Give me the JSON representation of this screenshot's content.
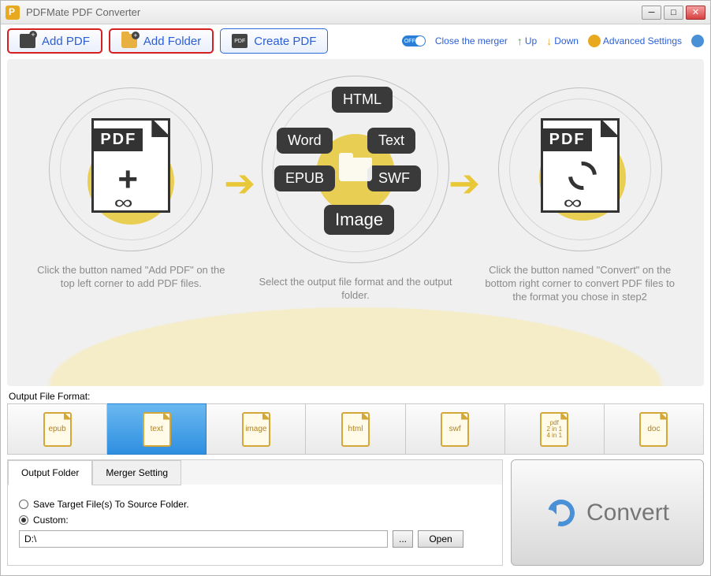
{
  "window": {
    "title": "PDFMate PDF Converter"
  },
  "toolbar": {
    "add_pdf": "Add PDF",
    "add_folder": "Add Folder",
    "create_pdf": "Create PDF",
    "toggle_label": "OFF",
    "close_merger": "Close the merger",
    "up": "Up",
    "down": "Down",
    "advanced": "Advanced Settings"
  },
  "steps": {
    "s1_label": "PDF",
    "s1_caption": "Click the button named \"Add PDF\" on the top left corner to add PDF files.",
    "s2_badges": {
      "html": "HTML",
      "word": "Word",
      "text": "Text",
      "epub": "EPUB",
      "swf": "SWF",
      "image": "Image"
    },
    "s2_caption": "Select the output file format and the output folder.",
    "s3_label": "PDF",
    "s3_caption": "Click the button named \"Convert\" on the bottom right corner to convert PDF files to the format you chose in step2"
  },
  "format_section": {
    "label": "Output File Format:",
    "items": [
      "epub",
      "text",
      "image",
      "html",
      "swf",
      "pdf\n2 in 1\n4 in 1",
      "doc"
    ],
    "selected_index": 1
  },
  "output": {
    "tab1": "Output Folder",
    "tab2": "Merger Setting",
    "opt_source": "Save Target File(s) To Source Folder.",
    "opt_custom": "Custom:",
    "path": "D:\\",
    "browse": "...",
    "open": "Open"
  },
  "convert": {
    "label": "Convert"
  }
}
